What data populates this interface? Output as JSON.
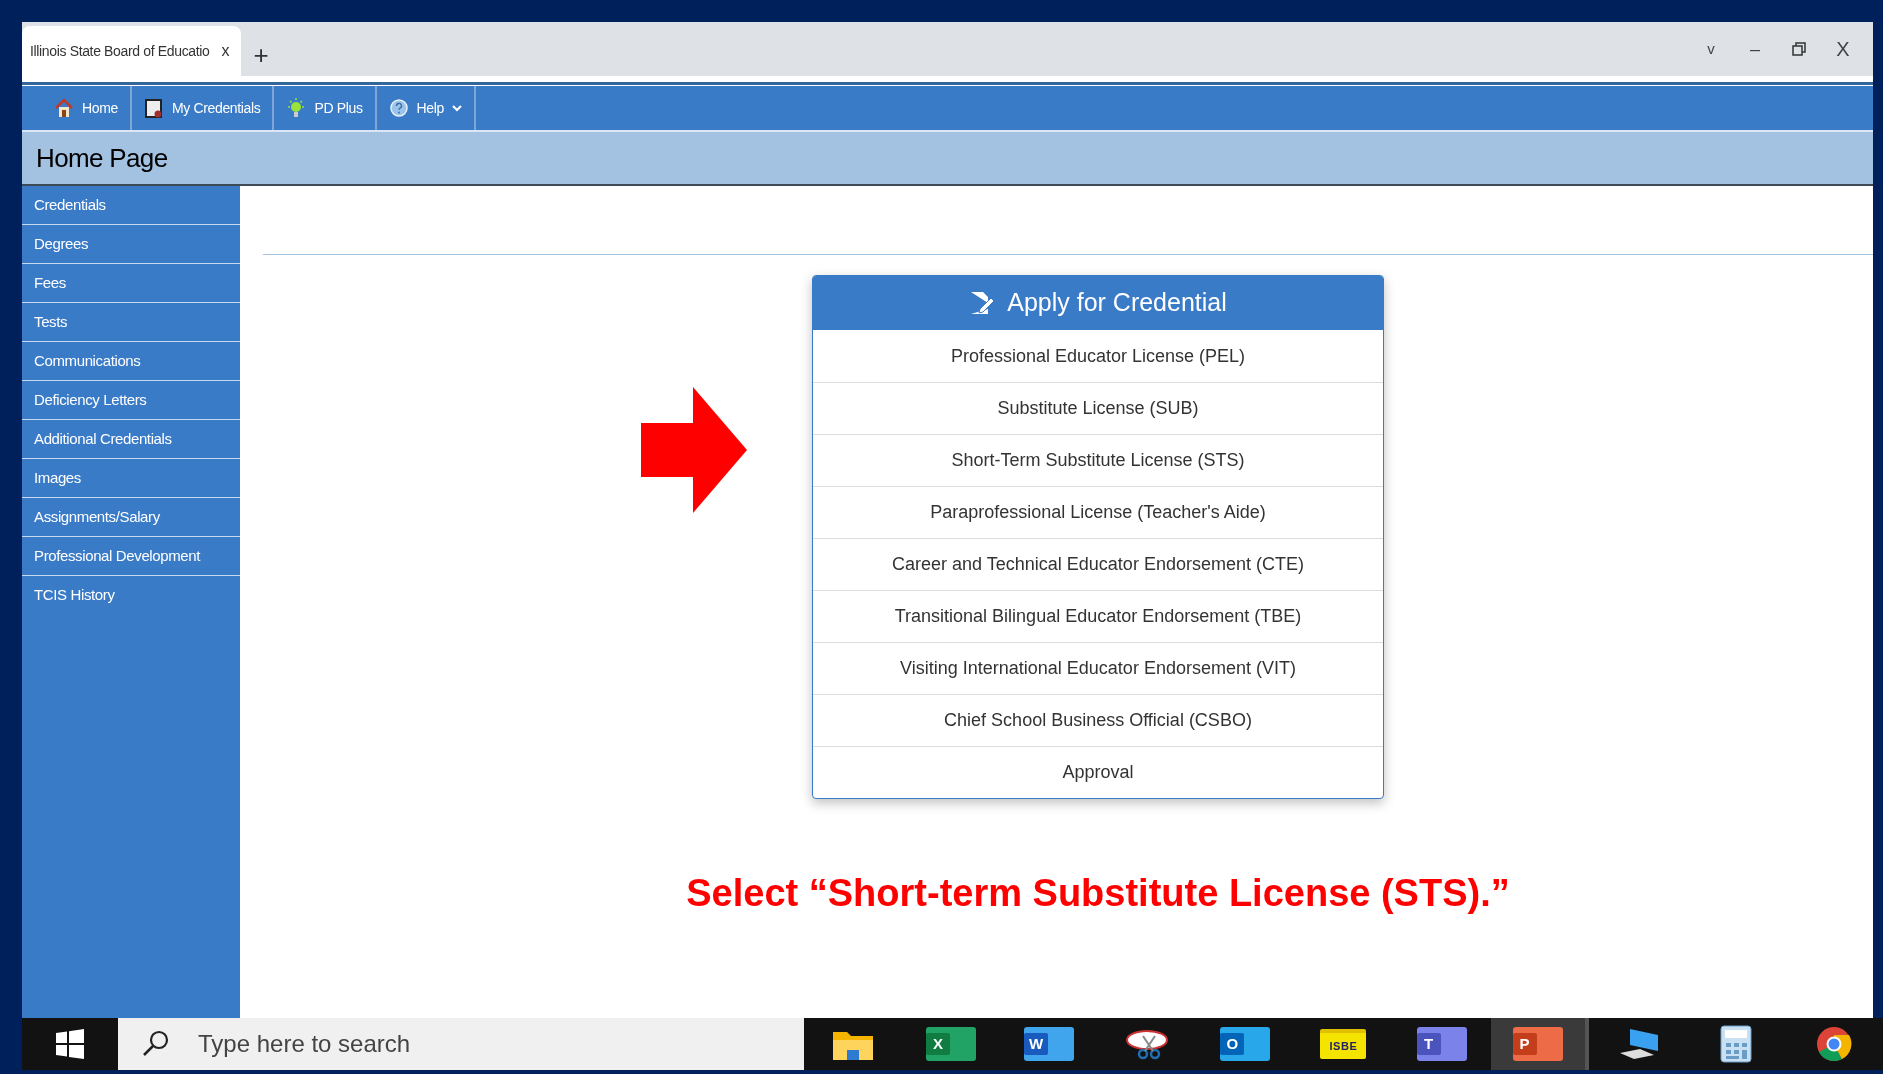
{
  "browser": {
    "tab_title": "Illinois State Board of Educatio",
    "tab_close": "x",
    "new_tab": "+",
    "controls": [
      {
        "kind": "dropdown",
        "glyph": "v"
      },
      {
        "kind": "minimize",
        "glyph": "–"
      },
      {
        "kind": "restore"
      },
      {
        "kind": "close",
        "glyph": "X"
      }
    ]
  },
  "nav": [
    {
      "kind": "home",
      "label": "Home",
      "dropdown": false
    },
    {
      "kind": "credentials",
      "label": "My Credentials",
      "dropdown": false
    },
    {
      "kind": "bulb",
      "label": "PD Plus",
      "dropdown": false
    },
    {
      "kind": "help",
      "label": "Help",
      "dropdown": true
    }
  ],
  "page_title": "Home Page",
  "sidebar": {
    "items": [
      "Credentials",
      "Degrees",
      "Fees",
      "Tests",
      "Communications",
      "Deficiency Letters",
      "Additional Credentials",
      "Images",
      "Assignments/Salary",
      "Professional Development",
      "TCIS History"
    ]
  },
  "card": {
    "title": "Apply for Credential",
    "options": [
      "Professional Educator License (PEL)",
      "Substitute License (SUB)",
      "Short-Term Substitute License (STS)",
      "Paraprofessional License (Teacher's Aide)",
      "Career and Technical Educator Endorsement (CTE)",
      "Transitional Bilingual Educator Endorsement (TBE)",
      "Visiting International Educator Endorsement (VIT)",
      "Chief School Business Official (CSBO)",
      "Approval"
    ]
  },
  "annotation": "Select “Short-term Substitute License (STS).”",
  "taskbar": {
    "search_placeholder": "Type here to search",
    "apps": [
      {
        "kind": "folder",
        "selected": false
      },
      {
        "kind": "excel",
        "letter": "X",
        "selected": false
      },
      {
        "kind": "word",
        "letter": "W",
        "selected": false
      },
      {
        "kind": "snip",
        "selected": false
      },
      {
        "kind": "outlook",
        "letter": "O",
        "selected": false
      },
      {
        "kind": "labeled-folder",
        "label": "ISBE",
        "selected": false
      },
      {
        "kind": "teams",
        "letter": "T",
        "selected": false
      },
      {
        "kind": "powerpoint",
        "letter": "P",
        "selected": true
      },
      {
        "kind": "desktop",
        "selected": false
      },
      {
        "kind": "calculator",
        "selected": false
      },
      {
        "kind": "chrome",
        "selected": false
      }
    ]
  }
}
